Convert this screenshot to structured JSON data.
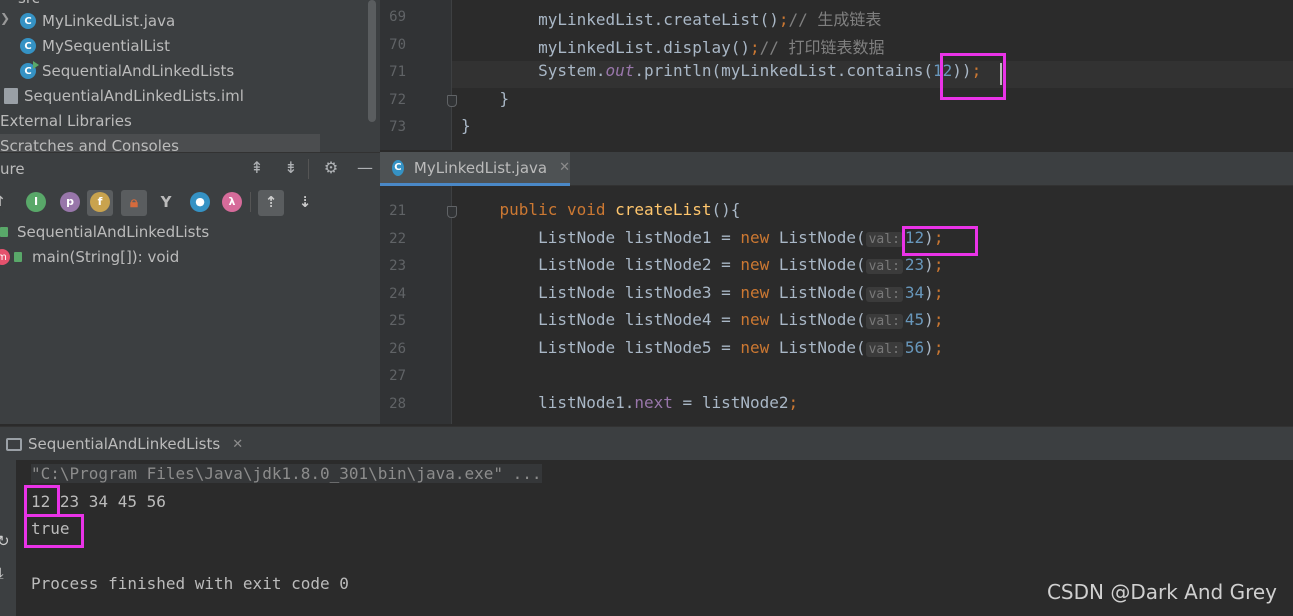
{
  "project_tree": {
    "items": [
      {
        "label": "src",
        "icon": "folder-icon"
      },
      {
        "label": "MyLinkedList.java",
        "icon": "class-icon"
      },
      {
        "label": "MySequentialList",
        "icon": "class-icon"
      },
      {
        "label": "SequentialAndLinkedLists",
        "icon": "runnable-class-icon"
      },
      {
        "label": "SequentialAndLinkedLists.iml",
        "icon": "module-file-icon"
      },
      {
        "label": "External Libraries",
        "icon": "library-icon"
      },
      {
        "label": "Scratches and Consoles",
        "icon": "scratches-icon"
      }
    ]
  },
  "structure_panel": {
    "title": "ure",
    "header_buttons": [
      "expand-all-icon",
      "collapse-all-icon",
      "gear-icon",
      "minimize-icon"
    ],
    "toolbar_icons": [
      {
        "letter": "I",
        "color": "#59a869",
        "icon": "inherited-icon"
      },
      {
        "letter": "p",
        "color": "#9876aa",
        "icon": "property-icon"
      },
      {
        "letter": "f",
        "color": "#c9a34e",
        "icon": "field-icon"
      },
      {
        "letter": "",
        "color": "#d66b3d",
        "icon": "lock-icon"
      },
      {
        "letter": "",
        "color": "#bbbbbb",
        "icon": "merge-icon"
      },
      {
        "letter": "",
        "color": "#3592c4",
        "icon": "anonymous-class-icon"
      },
      {
        "letter": "λ",
        "color": "#d66b9a",
        "icon": "lambda-icon"
      }
    ],
    "tree": [
      {
        "label": "SequentialAndLinkedLists"
      },
      {
        "label": "main(String[]): void"
      }
    ]
  },
  "editor_top": {
    "lines": [
      {
        "no": "69",
        "parts": [
          {
            "t": "        myLinkedList.createList()",
            "c": ""
          },
          {
            "t": ";",
            "c": "kw"
          },
          {
            "t": "// 生成链表",
            "c": "cmt"
          }
        ]
      },
      {
        "no": "70",
        "parts": [
          {
            "t": "        myLinkedList.display()",
            "c": ""
          },
          {
            "t": ";",
            "c": "kw"
          },
          {
            "t": "// 打印链表数据",
            "c": "cmt"
          }
        ]
      },
      {
        "no": "71",
        "parts": [
          {
            "t": "        System.",
            "c": ""
          },
          {
            "t": "out",
            "c": "static-field"
          },
          {
            "t": ".println(myLinkedList.contains(",
            "c": ""
          },
          {
            "t": "12",
            "c": "num"
          },
          {
            "t": "))",
            "c": ""
          },
          {
            "t": ";",
            "c": "kw"
          }
        ]
      },
      {
        "no": "72",
        "parts": [
          {
            "t": "    }",
            "c": ""
          }
        ]
      },
      {
        "no": "73",
        "parts": [
          {
            "t": "}",
            "c": ""
          }
        ]
      }
    ]
  },
  "editor_tab": {
    "label": "MyLinkedList.java",
    "close": "✕"
  },
  "editor_bottom": {
    "lines": [
      {
        "no": "21",
        "parts": [
          {
            "t": "    ",
            "c": ""
          },
          {
            "t": "public void ",
            "c": "kw"
          },
          {
            "t": "createList",
            "c": "fn"
          },
          {
            "t": "(){",
            "c": ""
          }
        ]
      },
      {
        "no": "22",
        "parts": [
          {
            "t": "        ListNode listNode1 = ",
            "c": ""
          },
          {
            "t": "new ",
            "c": "kw"
          },
          {
            "t": "ListNode(",
            "c": ""
          },
          {
            "t": "val:",
            "c": "hint"
          },
          {
            "t": "12",
            "c": "num"
          },
          {
            "t": ")",
            "c": ""
          },
          {
            "t": ";",
            "c": "kw"
          }
        ]
      },
      {
        "no": "23",
        "parts": [
          {
            "t": "        ListNode listNode2 = ",
            "c": ""
          },
          {
            "t": "new ",
            "c": "kw"
          },
          {
            "t": "ListNode(",
            "c": ""
          },
          {
            "t": "val:",
            "c": "hint"
          },
          {
            "t": "23",
            "c": "num"
          },
          {
            "t": ")",
            "c": ""
          },
          {
            "t": ";",
            "c": "kw"
          }
        ]
      },
      {
        "no": "24",
        "parts": [
          {
            "t": "        ListNode listNode3 = ",
            "c": ""
          },
          {
            "t": "new ",
            "c": "kw"
          },
          {
            "t": "ListNode(",
            "c": ""
          },
          {
            "t": "val:",
            "c": "hint"
          },
          {
            "t": "34",
            "c": "num"
          },
          {
            "t": ")",
            "c": ""
          },
          {
            "t": ";",
            "c": "kw"
          }
        ]
      },
      {
        "no": "25",
        "parts": [
          {
            "t": "        ListNode listNode4 = ",
            "c": ""
          },
          {
            "t": "new ",
            "c": "kw"
          },
          {
            "t": "ListNode(",
            "c": ""
          },
          {
            "t": "val:",
            "c": "hint"
          },
          {
            "t": "45",
            "c": "num"
          },
          {
            "t": ")",
            "c": ""
          },
          {
            "t": ";",
            "c": "kw"
          }
        ]
      },
      {
        "no": "26",
        "parts": [
          {
            "t": "        ListNode listNode5 = ",
            "c": ""
          },
          {
            "t": "new ",
            "c": "kw"
          },
          {
            "t": "ListNode(",
            "c": ""
          },
          {
            "t": "val:",
            "c": "hint"
          },
          {
            "t": "56",
            "c": "num"
          },
          {
            "t": ")",
            "c": ""
          },
          {
            "t": ";",
            "c": "kw"
          }
        ]
      },
      {
        "no": "27",
        "parts": [
          {
            "t": "",
            "c": ""
          }
        ]
      },
      {
        "no": "28",
        "parts": [
          {
            "t": "        listNode1.",
            "c": ""
          },
          {
            "t": "next",
            "c": "field"
          },
          {
            "t": " = listNode2",
            "c": ""
          },
          {
            "t": ";",
            "c": "kw"
          }
        ]
      }
    ]
  },
  "run_panel": {
    "tab_label": "SequentialAndLinkedLists",
    "tab_close": "✕",
    "command": "\"C:\\Program Files\\Java\\jdk1.8.0_301\\bin\\java.exe\" ...",
    "output_lines": [
      "12 23 34 45 56",
      "true",
      "",
      "Process finished with exit code 0"
    ]
  },
  "watermark": "CSDN @Dark And Grey",
  "colors": {
    "highlight": "#ea33e8",
    "keyword": "#cc7832",
    "number": "#6897bb",
    "function": "#ffc66d"
  }
}
